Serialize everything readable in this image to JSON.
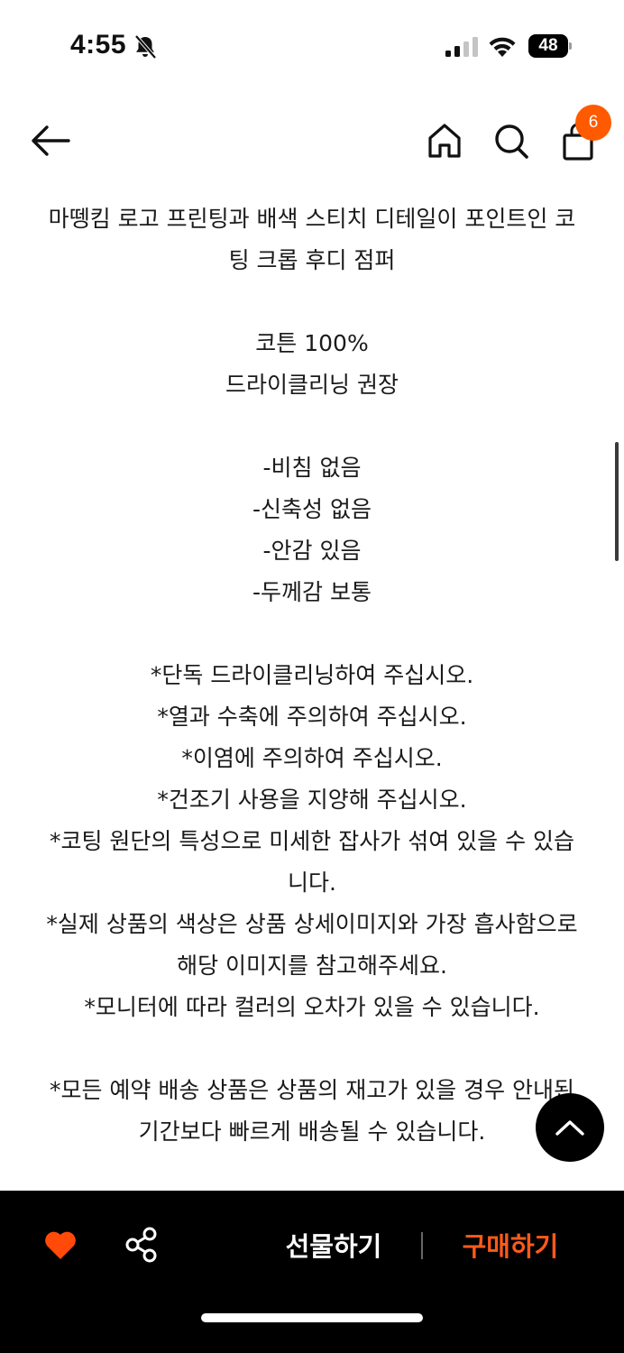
{
  "status_bar": {
    "time": "4:55",
    "battery_level": "48",
    "icons": [
      "bell-slash-icon",
      "signal-icon",
      "wifi-icon",
      "battery-icon"
    ]
  },
  "header": {
    "icons": [
      "back-arrow-icon",
      "home-icon",
      "search-icon",
      "shopping-bag-icon"
    ],
    "cart_count": "6"
  },
  "description": {
    "lines": [
      "마뗑킴 로고 프린팅과 배색 스티치 디테일이 포인트인 코",
      "팅 크롭 후디 점퍼",
      "",
      "코튼 100%",
      "드라이클리닝 권장",
      "",
      "-비침 없음",
      "-신축성 없음",
      "-안감 있음",
      "-두께감 보통",
      "",
      "*단독 드라이클리닝하여 주십시오.",
      "*열과 수축에 주의하여 주십시오.",
      "*이염에 주의하여 주십시오.",
      "*건조기 사용을 지양해 주십시오.",
      "*코팅 원단의 특성으로 미세한 잡사가 섞여 있을 수 있습",
      "니다.",
      "*실제 상품의 색상은 상품 상세이미지와 가장 흡사함으로",
      "해당 이미지를 참고해주세요.",
      "*모니터에 따라 컬러의 오차가 있을 수 있습니다.",
      "",
      "*모든 예약 배송 상품은 상품의 재고가 있을 경우 안내된",
      "기간보다 빠르게 배송될 수 있습니다."
    ]
  },
  "bottom_bar": {
    "gift_label": "선물하기",
    "buy_label": "구매하기",
    "icons": [
      "heart-icon",
      "share-icon"
    ]
  },
  "colors": {
    "accent": "#ff5a00",
    "bar_background": "#000000",
    "text": "#1a1a1a"
  }
}
